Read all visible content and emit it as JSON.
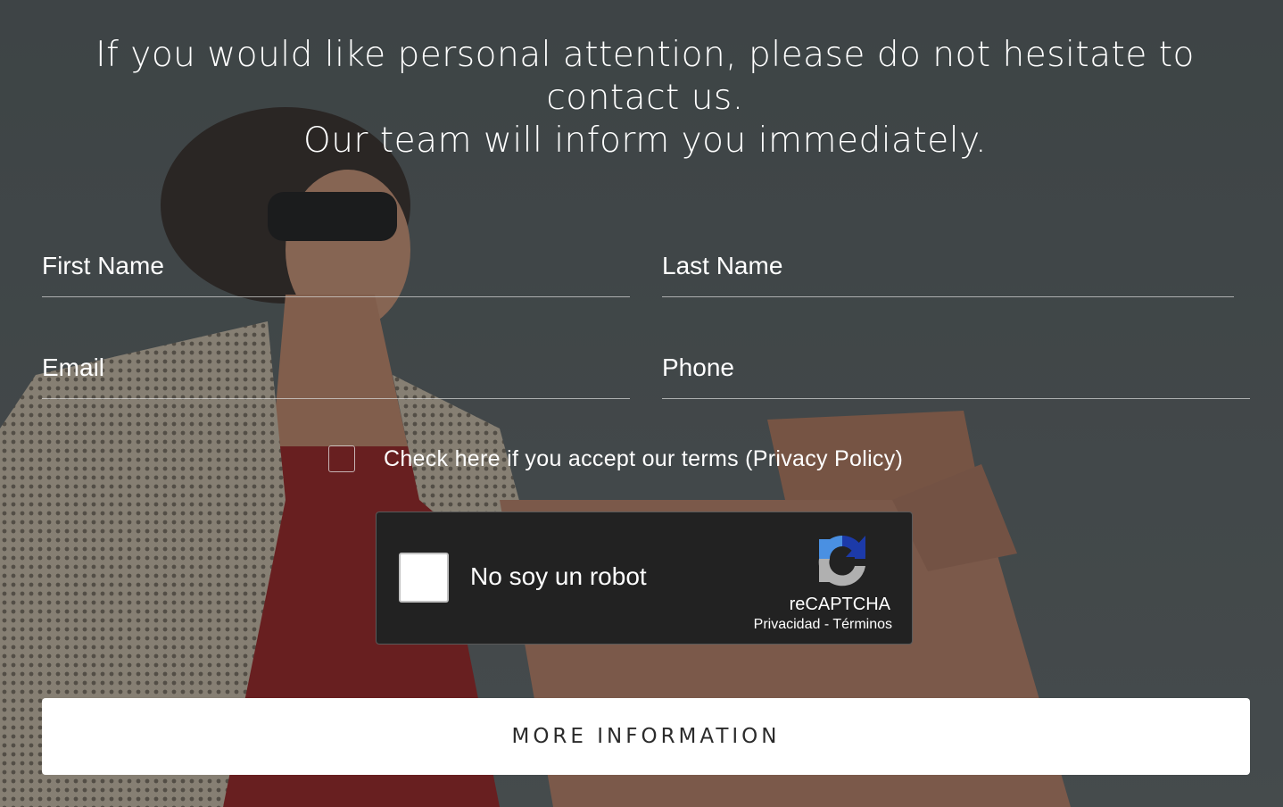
{
  "headline": {
    "line1": "If you would like personal attention, please do not hesitate to",
    "line2": "contact us.",
    "line3": "Our team will inform you immediately."
  },
  "form": {
    "first_name_label": "First Name",
    "last_name_label": "Last Name",
    "email_label": "Email",
    "phone_label": "Phone",
    "terms_label": "Check here if you accept our terms (Privacy Policy)",
    "submit_label": "MORE INFORMATION"
  },
  "recaptcha": {
    "label": "No soy un robot",
    "brand": "reCAPTCHA",
    "privacy": "Privacidad",
    "separator": " - ",
    "terms": "Términos",
    "logo_icon": "recaptcha-logo-icon"
  },
  "colors": {
    "recaptcha_blue": "#1c3aa9",
    "recaptcha_light_blue": "#4a90e2",
    "recaptcha_gray": "#b0b0b0",
    "button_bg": "#ffffff",
    "button_text": "#2b2b2b"
  }
}
